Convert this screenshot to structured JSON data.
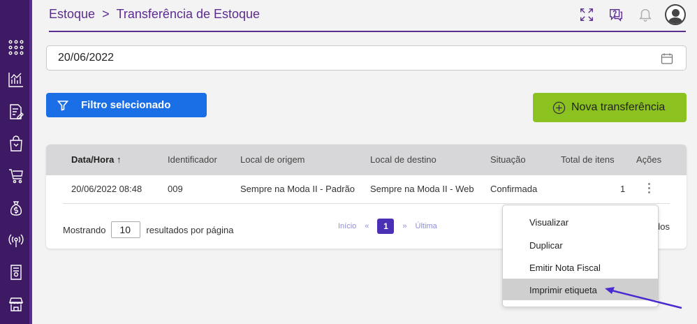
{
  "breadcrumb": {
    "section": "Estoque",
    "separator": ">",
    "page": "Transferência de Estoque"
  },
  "date_filter": {
    "value": "20/06/2022"
  },
  "buttons": {
    "filter": "Filtro selecionado",
    "new_transfer": "Nova transferência"
  },
  "table": {
    "headers": {
      "date": "Data/Hora",
      "sort_indicator": "↑",
      "id": "Identificador",
      "origin": "Local de origem",
      "destination": "Local de destino",
      "status": "Situação",
      "total": "Total de itens",
      "actions": "Ações"
    },
    "rows": [
      {
        "date": "20/06/2022 08:48",
        "id": "009",
        "origin": "Sempre na Moda II - Padrão",
        "destination": "Sempre na Moda II - Web",
        "status": "Confirmada",
        "total": "1"
      }
    ]
  },
  "pagination": {
    "showing_label": "Mostrando",
    "per_page": "10",
    "per_page_suffix": "resultados por página",
    "first": "Início",
    "prev": "«",
    "current": "1",
    "next": "»",
    "last": "Última",
    "tail": "dos"
  },
  "action_menu": {
    "items": [
      "Visualizar",
      "Duplicar",
      "Emitir Nota Fiscal",
      "Imprimir etiqueta"
    ],
    "highlighted_index": 3
  },
  "colors": {
    "sidebar": "#3d1a63",
    "accent": "#5b2c8f",
    "filter_button": "#1a6ee6",
    "new_button": "#8cc21f",
    "current_page": "#4b2fb4"
  },
  "icons": {
    "sidebar": [
      "apps-grid-icon",
      "chart-icon",
      "document-edit-icon",
      "shopping-bag-icon",
      "cart-icon",
      "money-bag-icon",
      "broadcast-icon",
      "receipt-icon",
      "store-icon"
    ],
    "header": [
      "fullscreen-icon",
      "help-chat-icon",
      "bell-icon",
      "user-avatar-icon"
    ]
  }
}
